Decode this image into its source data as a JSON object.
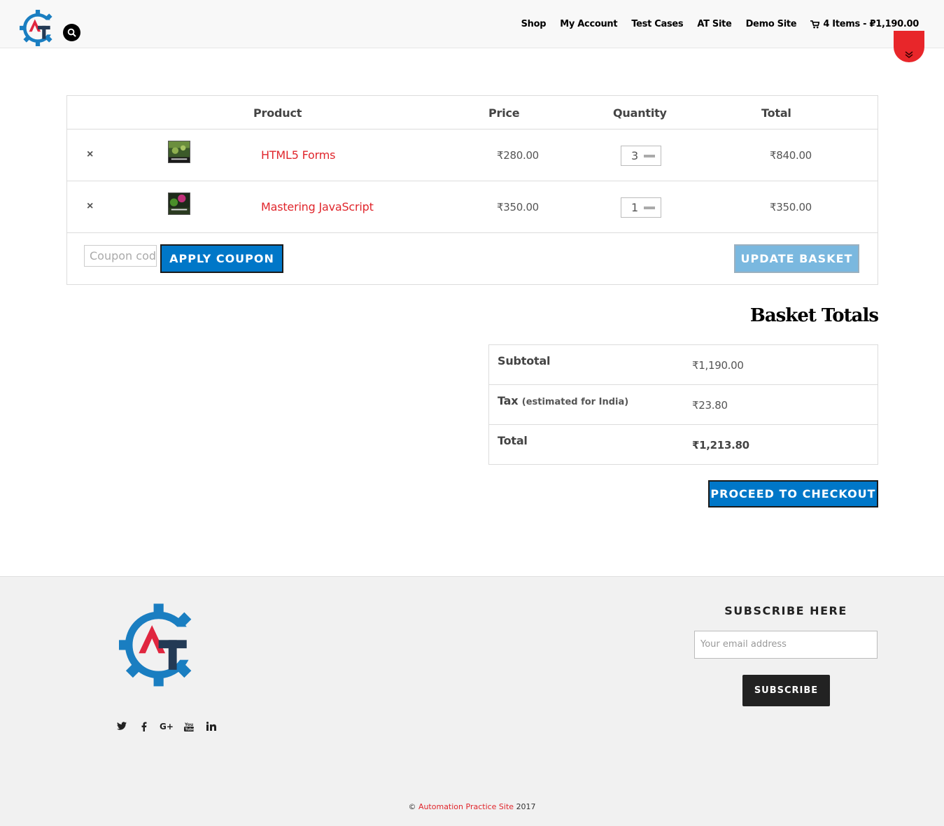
{
  "header": {
    "nav": [
      {
        "label": "Shop"
      },
      {
        "label": "My Account"
      },
      {
        "label": "Test Cases"
      },
      {
        "label": "AT Site"
      },
      {
        "label": "Demo Site"
      }
    ],
    "cart_label": "4 Items - ₽1,190.00"
  },
  "cart": {
    "headers": {
      "product": "Product",
      "price": "Price",
      "quantity": "Quantity",
      "total": "Total"
    },
    "items": [
      {
        "remove": "×",
        "name": "HTML5 Forms",
        "price": "₹280.00",
        "quantity": "3",
        "total": "₹840.00"
      },
      {
        "remove": "×",
        "name": "Mastering JavaScript",
        "price": "₹350.00",
        "quantity": "1",
        "total": "₹350.00"
      }
    ],
    "coupon_placeholder": "Coupon code",
    "apply_label": "APPLY COUPON",
    "update_label": "UPDATE BASKET"
  },
  "totals": {
    "title": "Basket Totals",
    "subtotal_label": "Subtotal",
    "subtotal_value": "₹1,190.00",
    "tax_label": "Tax",
    "tax_note": "(estimated for India)",
    "tax_value": "₹23.80",
    "total_label": "Total",
    "total_value": "₹1,213.80",
    "checkout_label": "PROCEED TO CHECKOUT"
  },
  "footer": {
    "subscribe_title": "SUBSCRIBE HERE",
    "email_placeholder": "Your email address",
    "subscribe_label": "SUBSCRIBE",
    "social_icons": [
      "twitter-icon",
      "facebook-icon",
      "google-plus-icon",
      "youtube-icon",
      "linkedin-icon"
    ],
    "copyright_symbol": "©",
    "copyright_link": "Automation Practice Site",
    "copyright_year": "2017"
  },
  "colors": {
    "accent_red": "#e0262c",
    "button_blue": "#0077c8",
    "button_disabled": "#7ab8df",
    "logo_blue": "#1a7ec1",
    "logo_navy": "#233a55"
  }
}
